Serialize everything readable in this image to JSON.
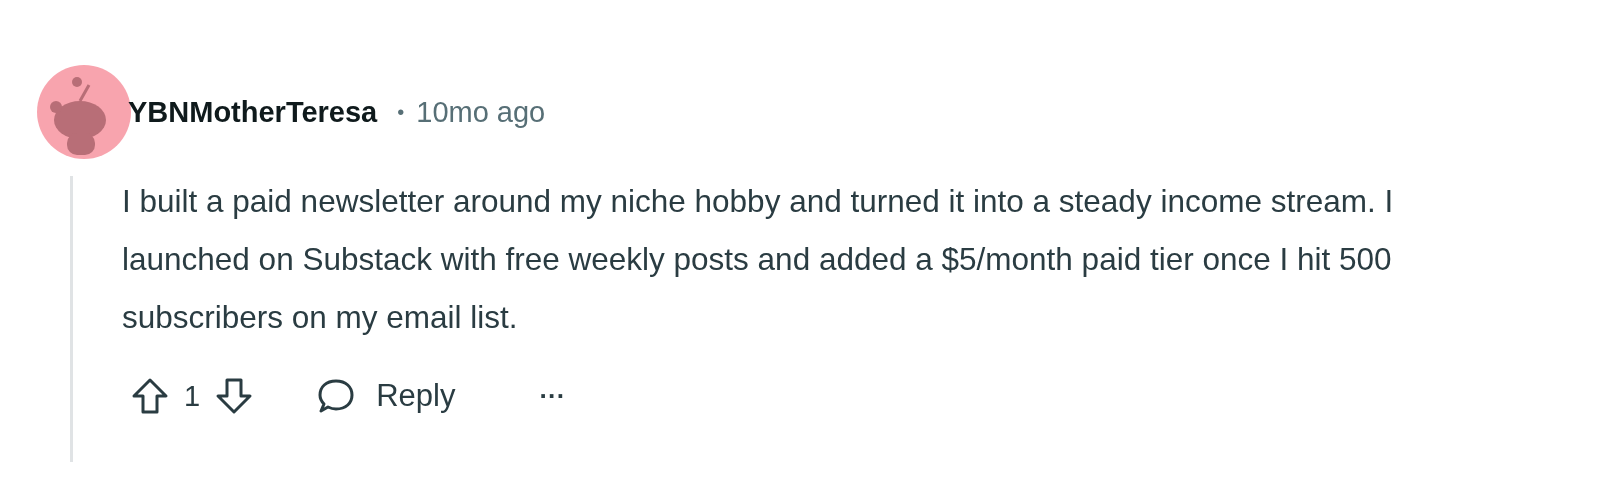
{
  "comment": {
    "author": "YBNMotherTeresa",
    "separator": "•",
    "time": "10mo ago",
    "body": "I built a paid newsletter around my niche hobby and turned it into a steady income stream. I launched on Substack with free weekly posts and added a $5/month paid tier once I hit 500 subscribers on my email list.",
    "votes": "1",
    "reply_label": "Reply",
    "more": "···"
  }
}
